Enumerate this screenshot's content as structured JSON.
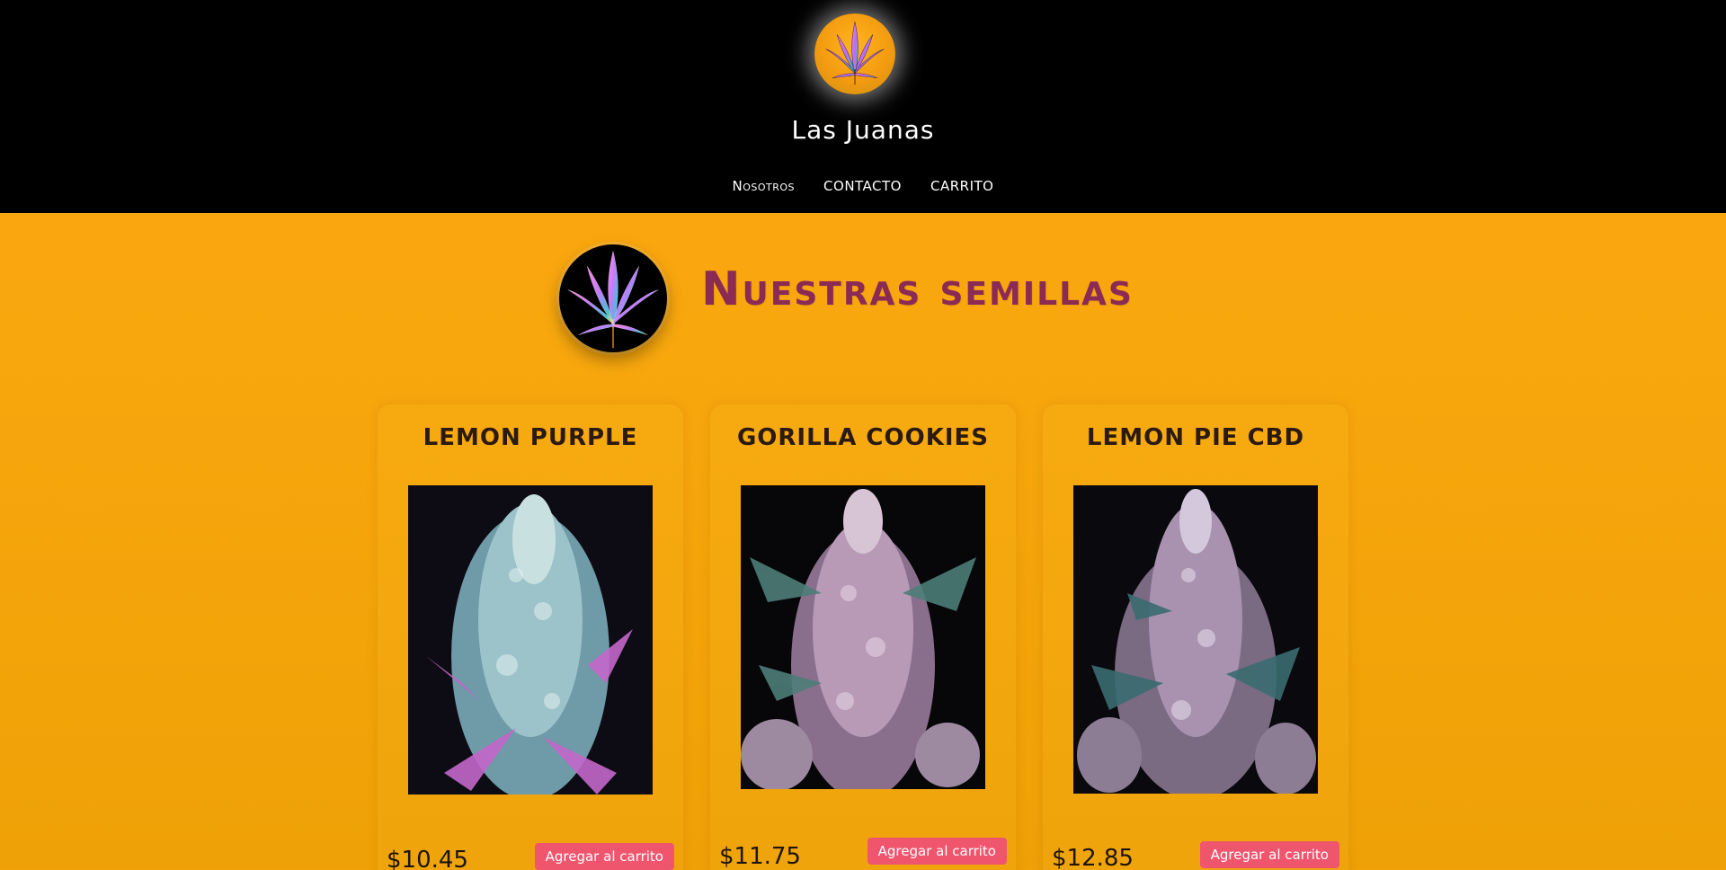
{
  "header": {
    "brand_name": "Las Juanas",
    "logo_icon": "cannabis-leaf-logo",
    "nav": [
      {
        "label": "Nosotros"
      },
      {
        "label": "Contacto"
      },
      {
        "label": "Carrito"
      }
    ]
  },
  "section": {
    "title": "Nuestras semillas",
    "logo_icon": "cannabis-leaf-logo"
  },
  "products": [
    {
      "name": "Lemon Purple",
      "price": "$10.45",
      "button_label": "Agregar al carrito"
    },
    {
      "name": "Gorilla Cookies",
      "price": "$11.75",
      "button_label": "Agregar al carrito"
    },
    {
      "name": "Lemon Pie CBD",
      "price": "$12.85",
      "button_label": "Agregar al carrito"
    }
  ],
  "colors": {
    "header_bg": "#000000",
    "page_bg": "#ffa511",
    "title_color": "#8b2a55",
    "button_bg": "#f0556e",
    "button_text": "#ffffff"
  }
}
